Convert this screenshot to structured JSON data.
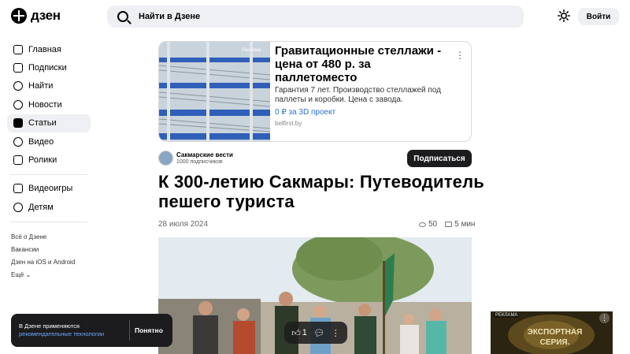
{
  "header": {
    "logo_text": "дзен",
    "search_placeholder": "Найти в Дзене",
    "login_label": "Войти"
  },
  "sidebar": {
    "items": [
      {
        "label": "Главная",
        "icon": "home-icon"
      },
      {
        "label": "Подписки",
        "icon": "subscriptions-icon"
      },
      {
        "label": "Найти",
        "icon": "search-icon"
      },
      {
        "label": "Новости",
        "icon": "news-icon"
      },
      {
        "label": "Статьи",
        "icon": "articles-icon",
        "active": true
      },
      {
        "label": "Видео",
        "icon": "video-icon"
      },
      {
        "label": "Ролики",
        "icon": "shorts-icon"
      }
    ],
    "items2": [
      {
        "label": "Видеоигры",
        "icon": "gamepad-icon"
      },
      {
        "label": "Детям",
        "icon": "kids-icon"
      }
    ],
    "footer_links": [
      "Всё о Дзене",
      "Вакансии",
      "Дзен на iOS и Android",
      "Ещё"
    ]
  },
  "ad": {
    "tag": "Реклама",
    "title": "Гравитационные стеллажи - цена от 480 р. за паллетоместо",
    "description": "Гарантия 7 лет. Производство стеллажей под паллеты и коробки. Цена с завода.",
    "price_link": "0 ₽ за 3D проект",
    "domain": "belfirst.by"
  },
  "channel": {
    "name": "Сакмарские вести",
    "subscribers": "1000 подписчиков",
    "subscribe_label": "Подписаться"
  },
  "article": {
    "title": "К 300-летию Сакмары: Путеводитель пешего туриста",
    "date": "28 июля 2024",
    "views": "50",
    "read_time": "5 мин"
  },
  "cookie": {
    "text_line1": "В Дзене применяются",
    "text_line2": "рекомендательные технологии",
    "button": "Понятно"
  },
  "actions": {
    "likes": "1"
  },
  "ad2": {
    "tag": "РЕКЛАМА",
    "text": "ЭКСПОРТНАЯ СЕРИЯ."
  },
  "colors": {
    "accent_link": "#2a6fd6",
    "dark": "#1c1c1e",
    "search_bg": "#eef0f3"
  }
}
